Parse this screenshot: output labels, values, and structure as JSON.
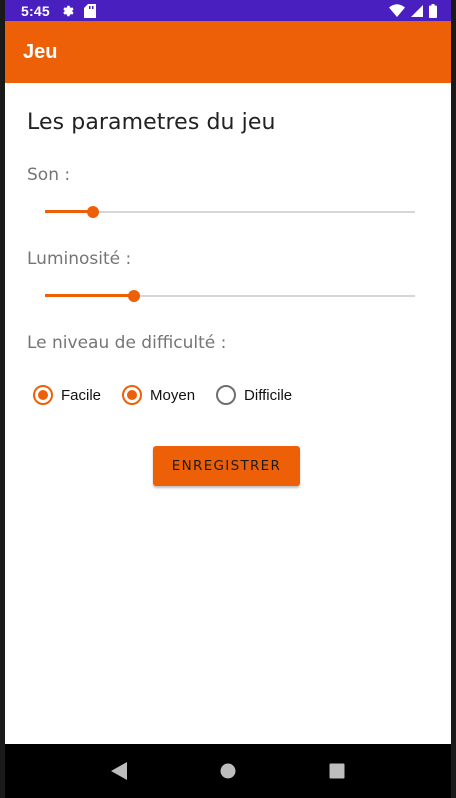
{
  "status_bar": {
    "time": "5:45",
    "icons": [
      "gear-icon",
      "sd-card-icon",
      "wifi-icon",
      "cellular-icon",
      "battery-icon"
    ],
    "background_color": "#4a1fbf"
  },
  "app_bar": {
    "title": "Jeu",
    "color": "#ee6007"
  },
  "content": {
    "heading": "Les parametres du jeu",
    "son_label": "Son :",
    "son_value": 0.13,
    "luminosite_label": "Luminosité :",
    "luminosite_value": 0.24,
    "difficulty_label": "Le niveau de difficulté :",
    "options": [
      {
        "label": "Facile",
        "checked": true
      },
      {
        "label": "Moyen",
        "checked": true
      },
      {
        "label": "Difficile",
        "checked": false
      }
    ],
    "save_label": "ENREGISTRER"
  },
  "nav_bar": {
    "buttons": [
      "back-icon",
      "home-icon",
      "recents-icon"
    ]
  }
}
